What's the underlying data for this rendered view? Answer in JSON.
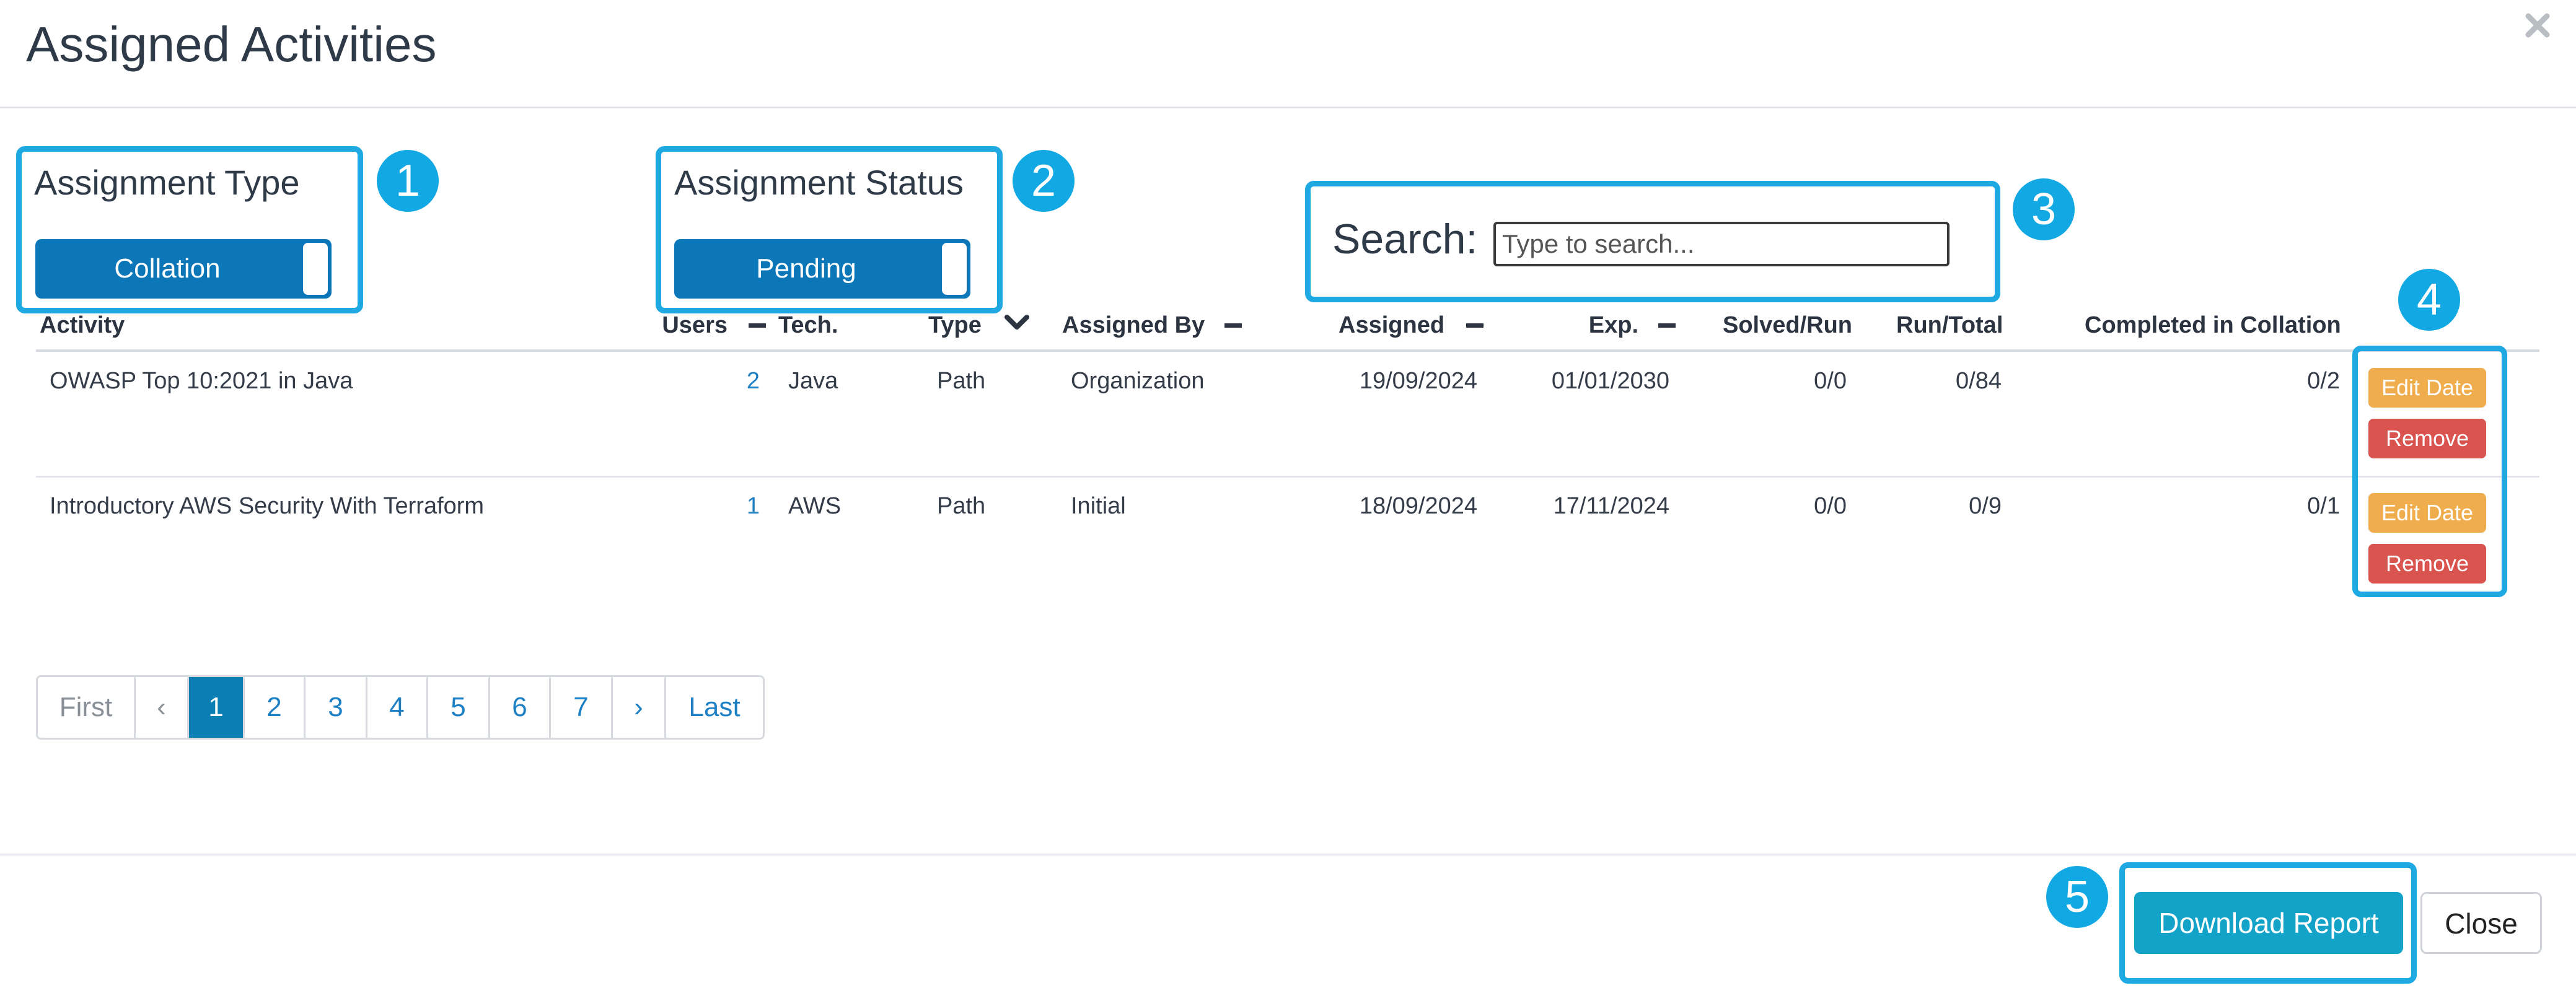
{
  "modal": {
    "title": "Assigned Activities"
  },
  "callouts": [
    "1",
    "2",
    "3",
    "4",
    "5"
  ],
  "filters": {
    "assignment_type_label": "Assignment Type",
    "assignment_type_value": "Collation",
    "assignment_status_label": "Assignment Status",
    "assignment_status_value": "Pending",
    "search_label": "Search:",
    "search_placeholder": "Type to search..."
  },
  "table": {
    "columns": {
      "activity": "Activity",
      "users": "Users",
      "tech": "Tech.",
      "type": "Type",
      "assigned_by": "Assigned By",
      "assigned": "Assigned",
      "exp": "Exp.",
      "solved_run": "Solved/Run",
      "run_total": "Run/Total",
      "completed": "Completed in Collation"
    },
    "rows": [
      {
        "activity": "OWASP Top 10:2021 in Java",
        "users": "2",
        "tech": "Java",
        "type": "Path",
        "assigned_by": "Organization",
        "assigned": "19/09/2024",
        "exp": "01/01/2030",
        "solved_run": "0/0",
        "run_total": "0/84",
        "completed": "0/2",
        "edit_label": "Edit Date",
        "remove_label": "Remove"
      },
      {
        "activity": "Introductory AWS Security With Terraform",
        "users": "1",
        "tech": "AWS",
        "type": "Path",
        "assigned_by": "Initial",
        "assigned": "18/09/2024",
        "exp": "17/11/2024",
        "solved_run": "0/0",
        "run_total": "0/9",
        "completed": "0/1",
        "edit_label": "Edit Date",
        "remove_label": "Remove"
      }
    ]
  },
  "pagination": {
    "first": "First",
    "prev": "‹",
    "pages": [
      "1",
      "2",
      "3",
      "4",
      "5",
      "6",
      "7"
    ],
    "next": "›",
    "last": "Last",
    "current": "1"
  },
  "footer": {
    "download_label": "Download Report",
    "close_label": "Close"
  },
  "colors": {
    "callout": "#1ea9e2",
    "toggle": "#0b76b8",
    "edit": "#f0ad4e",
    "remove": "#d9534f",
    "download": "#13a3c9",
    "page_active": "#0b7fb3"
  }
}
